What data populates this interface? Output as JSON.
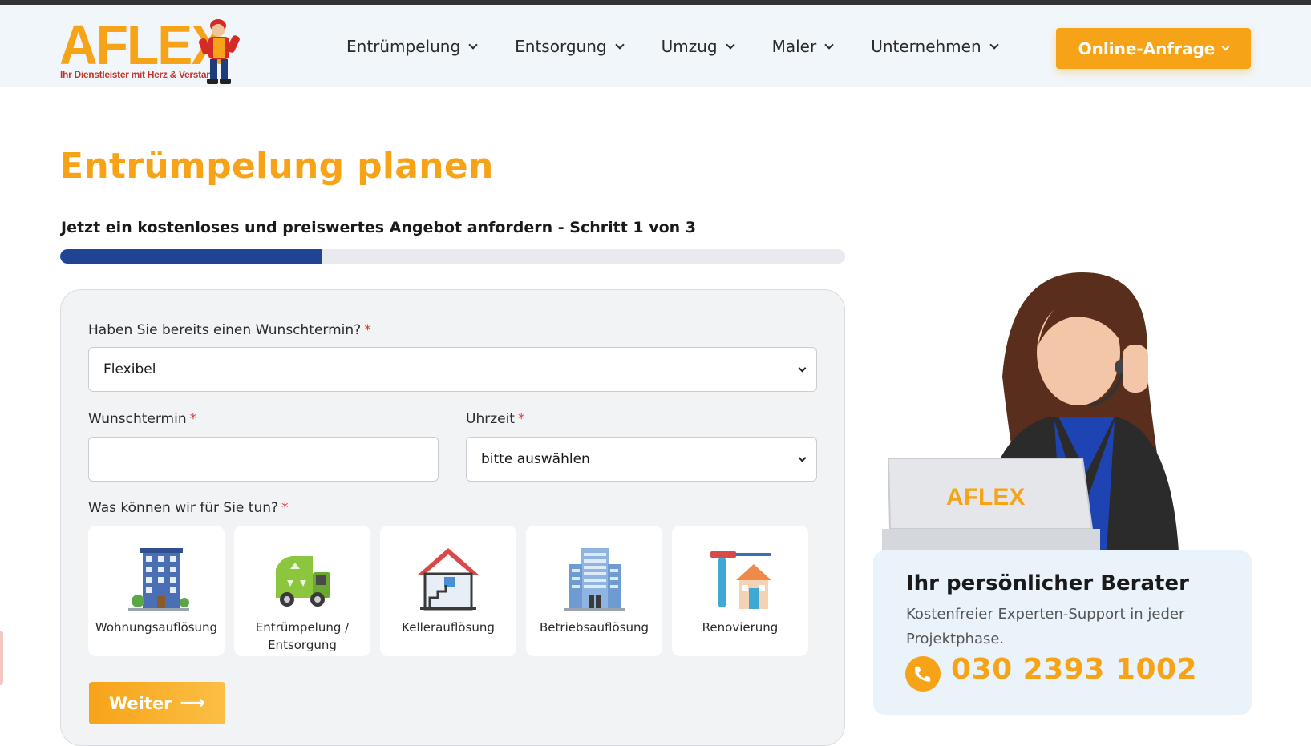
{
  "header": {
    "logo_text": "AFLEX",
    "logo_tagline": "Ihr Dienstleister mit Herz & Verstand",
    "nav": [
      {
        "label": "Entrümpelung"
      },
      {
        "label": "Entsorgung"
      },
      {
        "label": "Umzug"
      },
      {
        "label": "Maler"
      },
      {
        "label": "Unternehmen"
      }
    ],
    "cta_label": "Online-Anfrage"
  },
  "main": {
    "title": "Entrümpelung planen",
    "subtitle": "Jetzt ein kostenloses und preiswertes Angebot anfordern - Schritt 1 von 3",
    "progress_fraction": 0.333
  },
  "form": {
    "wunschtermin_question": {
      "label": "Haben Sie bereits einen Wunschtermin?",
      "required_mark": "*",
      "value": "Flexibel"
    },
    "wunschtermin": {
      "label": "Wunschtermin",
      "required_mark": "*",
      "value": ""
    },
    "uhrzeit": {
      "label": "Uhrzeit",
      "required_mark": "*",
      "value": "bitte auswählen"
    },
    "services_label": "Was können wir für Sie tun?",
    "services_required_mark": "*",
    "services": [
      {
        "label": "Wohnungsauflösung",
        "icon": "apartment-building-icon"
      },
      {
        "label": "Entrümpelung / Entsorgung",
        "icon": "recycling-truck-icon"
      },
      {
        "label": "Kellerauflösung",
        "icon": "basement-house-icon"
      },
      {
        "label": "Betriebsauflösung",
        "icon": "office-building-icon"
      },
      {
        "label": "Renovierung",
        "icon": "renovation-tools-icon"
      }
    ],
    "submit_label": "Weiter",
    "submit_arrow": "⟶"
  },
  "berater": {
    "title": "Ihr persönlicher Berater",
    "text": "Kostenfreier Experten-Support in jeder Projektphase.",
    "phone": "030 2393 1002",
    "laptop_logo": "AFLEX"
  },
  "colors": {
    "accent": "#f7a318",
    "progress": "#1f4494",
    "header_bg": "#f1f6fb",
    "required": "#e0362c"
  }
}
